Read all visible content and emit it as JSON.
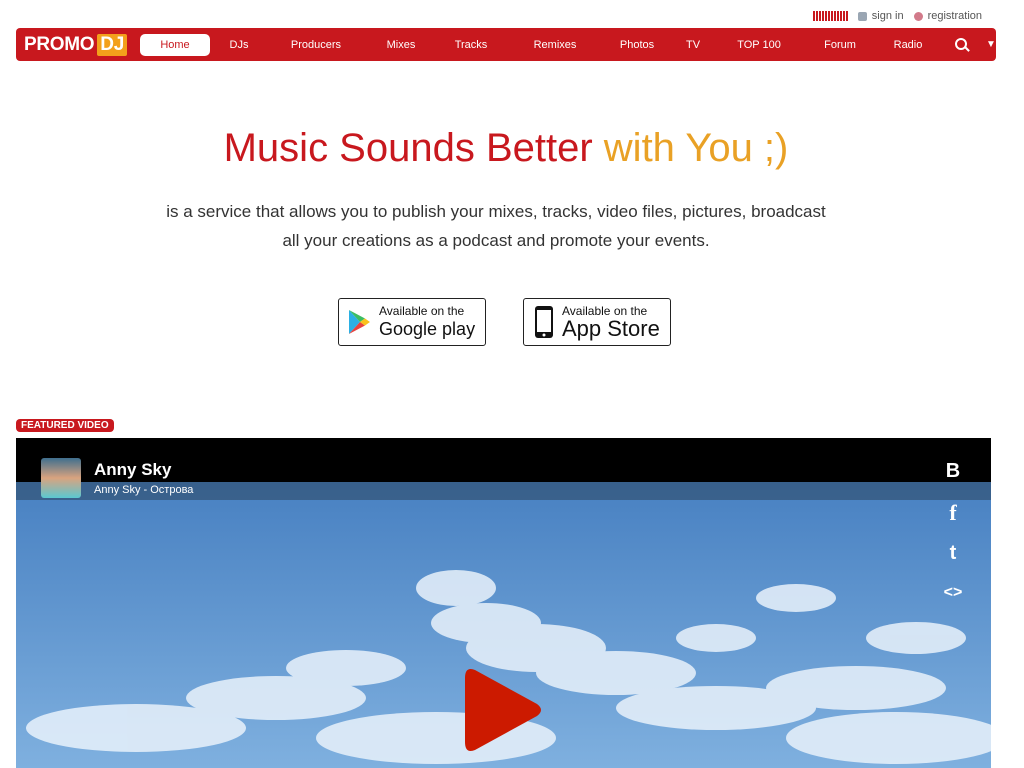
{
  "topbar": {
    "signin": "sign in",
    "registration": "registration"
  },
  "brand": {
    "logo_promo": "PROMO",
    "logo_dj": "DJ"
  },
  "nav": {
    "items": [
      "Home",
      "DJs",
      "Producers",
      "Mixes",
      "Tracks",
      "Remixes",
      "Photos",
      "TV",
      "TOP 100",
      "Forum",
      "Radio"
    ],
    "caret": "▼"
  },
  "hero": {
    "title_main": "Music Sounds Better",
    "title_accent": "with You ;)",
    "brand_promo": "",
    "brand_dj": "",
    "desc_line1_rest": " is a service that allows you to publish your mixes, tracks, video files, pictures, broadcast",
    "desc_line2": "all your creations as a podcast and promote your events."
  },
  "stores": {
    "google_small": "Available on the",
    "google_big": "Google play",
    "apple_small": "Available on the",
    "apple_big": "App Store"
  },
  "featured": {
    "badge": "FEATURED VIDEO",
    "artist": "Anny Sky",
    "subtitle": "Anny Sky - Острова",
    "share_vk": "B",
    "share_fb": "f",
    "share_tw": "t",
    "share_embed": "<>"
  },
  "colors": {
    "brand_red": "#c8181e",
    "brand_orange": "#e9a125",
    "play_red": "#cc1a00"
  }
}
